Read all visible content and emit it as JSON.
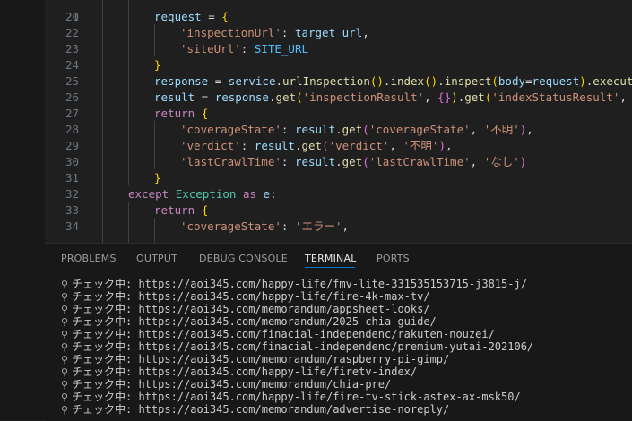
{
  "editor": {
    "lines": [
      {
        "num": "21",
        "tokens": [
          {
            "t": "request",
            "c": "var"
          },
          {
            "t": " = ",
            "c": "pun"
          },
          {
            "t": "{",
            "c": "b1"
          }
        ]
      },
      {
        "num": "22",
        "tokens": [
          {
            "t": "'inspectionUrl'",
            "c": "str"
          },
          {
            "t": ": ",
            "c": "pun"
          },
          {
            "t": "target_url",
            "c": "var"
          },
          {
            "t": ",",
            "c": "pun"
          }
        ]
      },
      {
        "num": "23",
        "tokens": [
          {
            "t": "'siteUrl'",
            "c": "str"
          },
          {
            "t": ": ",
            "c": "pun"
          },
          {
            "t": "SITE_URL",
            "c": "const"
          }
        ]
      },
      {
        "num": "24",
        "tokens": [
          {
            "t": "}",
            "c": "b1"
          }
        ]
      },
      {
        "num": "25",
        "tokens": [
          {
            "t": "response",
            "c": "var"
          },
          {
            "t": " = ",
            "c": "pun"
          },
          {
            "t": "service",
            "c": "var"
          },
          {
            "t": ".",
            "c": "pun"
          },
          {
            "t": "urlInspection",
            "c": "fn"
          },
          {
            "t": "()",
            "c": "b1"
          },
          {
            "t": ".",
            "c": "pun"
          },
          {
            "t": "index",
            "c": "fn"
          },
          {
            "t": "()",
            "c": "b1"
          },
          {
            "t": ".",
            "c": "pun"
          },
          {
            "t": "inspect",
            "c": "fn"
          },
          {
            "t": "(",
            "c": "b1"
          },
          {
            "t": "body",
            "c": "var"
          },
          {
            "t": "=",
            "c": "pun"
          },
          {
            "t": "request",
            "c": "var"
          },
          {
            "t": ")",
            "c": "b1"
          },
          {
            "t": ".",
            "c": "pun"
          },
          {
            "t": "execute",
            "c": "fn"
          },
          {
            "t": "()",
            "c": "b1"
          }
        ]
      },
      {
        "num": "26",
        "tokens": [
          {
            "t": "result",
            "c": "var"
          },
          {
            "t": " = ",
            "c": "pun"
          },
          {
            "t": "response",
            "c": "var"
          },
          {
            "t": ".",
            "c": "pun"
          },
          {
            "t": "get",
            "c": "fn"
          },
          {
            "t": "(",
            "c": "b1"
          },
          {
            "t": "'inspectionResult'",
            "c": "str"
          },
          {
            "t": ", ",
            "c": "pun"
          },
          {
            "t": "{}",
            "c": "b2"
          },
          {
            "t": ")",
            "c": "b1"
          },
          {
            "t": ".",
            "c": "pun"
          },
          {
            "t": "get",
            "c": "fn"
          },
          {
            "t": "(",
            "c": "b1"
          },
          {
            "t": "'indexStatusResult'",
            "c": "str"
          },
          {
            "t": ", ",
            "c": "pun"
          },
          {
            "t": "{}",
            "c": "b2"
          },
          {
            "t": ")",
            "c": "b1"
          }
        ]
      },
      {
        "num": "27",
        "tokens": [
          {
            "t": "return",
            "c": "kw"
          },
          {
            "t": " ",
            "c": "pun"
          },
          {
            "t": "{",
            "c": "b1"
          }
        ]
      },
      {
        "num": "28",
        "tokens": [
          {
            "t": "'coverageState'",
            "c": "str"
          },
          {
            "t": ": ",
            "c": "pun"
          },
          {
            "t": "result",
            "c": "var"
          },
          {
            "t": ".",
            "c": "pun"
          },
          {
            "t": "get",
            "c": "fn"
          },
          {
            "t": "(",
            "c": "b2"
          },
          {
            "t": "'coverageState'",
            "c": "str"
          },
          {
            "t": ", ",
            "c": "pun"
          },
          {
            "t": "'不明'",
            "c": "str"
          },
          {
            "t": ")",
            "c": "b2"
          },
          {
            "t": ",",
            "c": "pun"
          }
        ]
      },
      {
        "num": "29",
        "tokens": [
          {
            "t": "'verdict'",
            "c": "str"
          },
          {
            "t": ": ",
            "c": "pun"
          },
          {
            "t": "result",
            "c": "var"
          },
          {
            "t": ".",
            "c": "pun"
          },
          {
            "t": "get",
            "c": "fn"
          },
          {
            "t": "(",
            "c": "b2"
          },
          {
            "t": "'verdict'",
            "c": "str"
          },
          {
            "t": ", ",
            "c": "pun"
          },
          {
            "t": "'不明'",
            "c": "str"
          },
          {
            "t": ")",
            "c": "b2"
          },
          {
            "t": ",",
            "c": "pun"
          }
        ]
      },
      {
        "num": "30",
        "tokens": [
          {
            "t": "'lastCrawlTime'",
            "c": "str"
          },
          {
            "t": ": ",
            "c": "pun"
          },
          {
            "t": "result",
            "c": "var"
          },
          {
            "t": ".",
            "c": "pun"
          },
          {
            "t": "get",
            "c": "fn"
          },
          {
            "t": "(",
            "c": "b2"
          },
          {
            "t": "'lastCrawlTime'",
            "c": "str"
          },
          {
            "t": ", ",
            "c": "pun"
          },
          {
            "t": "'なし'",
            "c": "str"
          },
          {
            "t": ")",
            "c": "b2"
          }
        ]
      },
      {
        "num": "31",
        "tokens": [
          {
            "t": "}",
            "c": "b1"
          }
        ]
      },
      {
        "num": "32",
        "tokens": [
          {
            "t": "except",
            "c": "kw"
          },
          {
            "t": " ",
            "c": "pun"
          },
          {
            "t": "Exception",
            "c": "cls"
          },
          {
            "t": " ",
            "c": "pun"
          },
          {
            "t": "as",
            "c": "kw"
          },
          {
            "t": " ",
            "c": "pun"
          },
          {
            "t": "e",
            "c": "var"
          },
          {
            "t": ":",
            "c": "pun"
          }
        ]
      },
      {
        "num": "33",
        "tokens": [
          {
            "t": "return",
            "c": "kw"
          },
          {
            "t": " ",
            "c": "pun"
          },
          {
            "t": "{",
            "c": "b1"
          }
        ]
      },
      {
        "num": "34",
        "tokens": [
          {
            "t": "'coverageState'",
            "c": "str"
          },
          {
            "t": ": ",
            "c": "pun"
          },
          {
            "t": "'エラー'",
            "c": "str"
          },
          {
            "t": ",",
            "c": "pun"
          }
        ]
      }
    ]
  },
  "panel": {
    "tabs": [
      {
        "label": "PROBLEMS",
        "active": false
      },
      {
        "label": "OUTPUT",
        "active": false
      },
      {
        "label": "DEBUG CONSOLE",
        "active": false
      },
      {
        "label": "TERMINAL",
        "active": true
      },
      {
        "label": "PORTS",
        "active": false
      }
    ],
    "terminal": {
      "prefix": "チェック中:",
      "icon": "magnifier-icon",
      "lines": [
        "https://aoi345.com/happy-life/fmv-lite-331535153715-j3815-j/",
        "https://aoi345.com/happy-life/fire-4k-max-tv/",
        "https://aoi345.com/memorandum/appsheet-looks/",
        "https://aoi345.com/memorandum/2025-chia-guide/",
        "https://aoi345.com/finacial-independenc/rakuten-nouzei/",
        "https://aoi345.com/finacial-independenc/premium-yutai-202106/",
        "https://aoi345.com/memorandum/raspberry-pi-gimp/",
        "https://aoi345.com/happy-life/firetv-index/",
        "https://aoi345.com/memorandum/chia-pre/",
        "https://aoi345.com/happy-life/fire-tv-stick-astex-ax-msk50/",
        "https://aoi345.com/memorandum/advertise-noreply/"
      ]
    }
  },
  "colors": {
    "editor_bg": "#1f1f1f",
    "panel_bg": "#181818",
    "keyword": "#c586c0",
    "variable": "#9cdcfe",
    "string": "#ce9178",
    "function": "#dcdcaa",
    "class": "#4ec9b0",
    "constant": "#4fc1ff",
    "active_tab_underline": "#0078d4"
  }
}
